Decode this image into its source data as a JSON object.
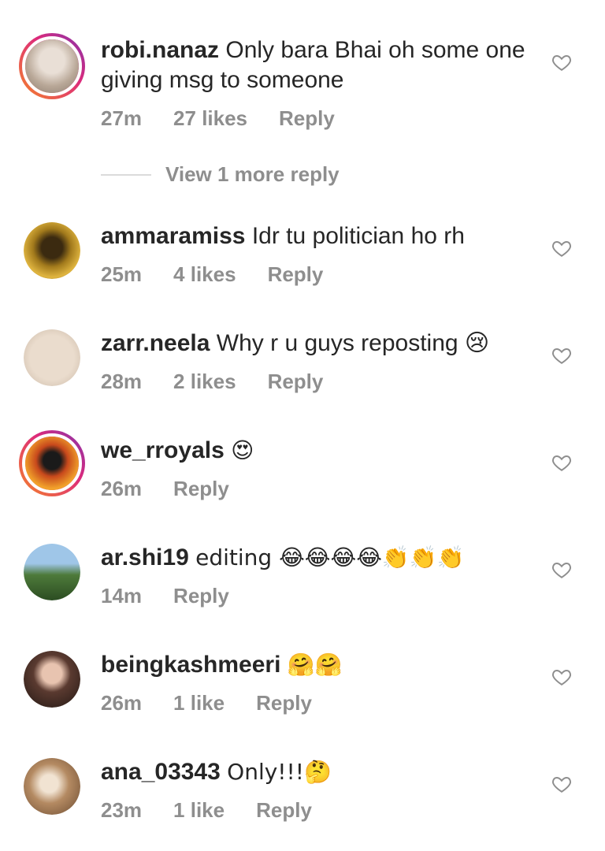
{
  "top_cut_text": "...",
  "comments": [
    {
      "username": "robi.nanaz",
      "text": "Only bara Bhai oh some one giving msg to someone",
      "time": "27m",
      "likes": "27 likes",
      "reply": "Reply"
    },
    {
      "username": "ammaramiss",
      "text": "Idr tu politician ho rh",
      "time": "25m",
      "likes": "4 likes",
      "reply": "Reply"
    },
    {
      "username": "zarr.neela",
      "text": "Why r u guys reposting 😢",
      "time": "28m",
      "likes": "2 likes",
      "reply": "Reply"
    },
    {
      "username": "we_rroyals",
      "text": "😍",
      "time": "26m",
      "likes": "",
      "reply": "Reply"
    },
    {
      "username": "ar.shi19",
      "text": "editing 😂😂😂😂👏👏👏",
      "time": "14m",
      "likes": "",
      "reply": "Reply"
    },
    {
      "username": "beingkashmeeri",
      "text": "🤗🤗",
      "time": "26m",
      "likes": "1 like",
      "reply": "Reply"
    },
    {
      "username": "ana_03343",
      "text": "Only!!!🤔",
      "time": "23m",
      "likes": "1 like",
      "reply": "Reply"
    }
  ],
  "view_more_replies": "View 1 more reply",
  "colors": {
    "text": "#262626",
    "muted": "#8e8e8e",
    "story_ring_start": "#f58529",
    "story_ring_end": "#8134af"
  },
  "icons": {
    "like": "heart-outline-icon"
  }
}
